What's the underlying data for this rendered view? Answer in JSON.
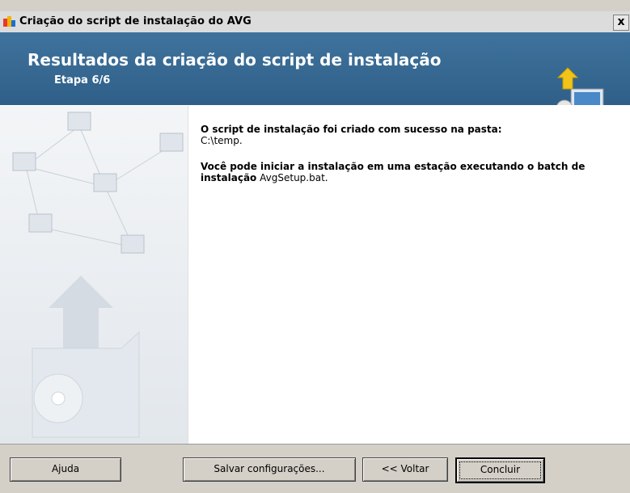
{
  "window": {
    "title": "Criação do script de instalação do AVG",
    "close_label": "x"
  },
  "header": {
    "title": "Resultados da criação do script de instalação",
    "step": "Etapa 6/6"
  },
  "content": {
    "para1_bold": "O script de instalação foi criado com sucesso na pasta:",
    "para1_path": "C:\\temp.",
    "para2_bold": "Você pode iniciar a instalação em uma estação executando o batch de instalação",
    "para2_file": "AvgSetup.bat."
  },
  "buttons": {
    "help": "Ajuda",
    "save": "Salvar configurações...",
    "back": "<< Voltar",
    "finish": "Concluir"
  },
  "colors": {
    "header_bg": "#3f739d",
    "window_bg": "#d4d0c8"
  }
}
